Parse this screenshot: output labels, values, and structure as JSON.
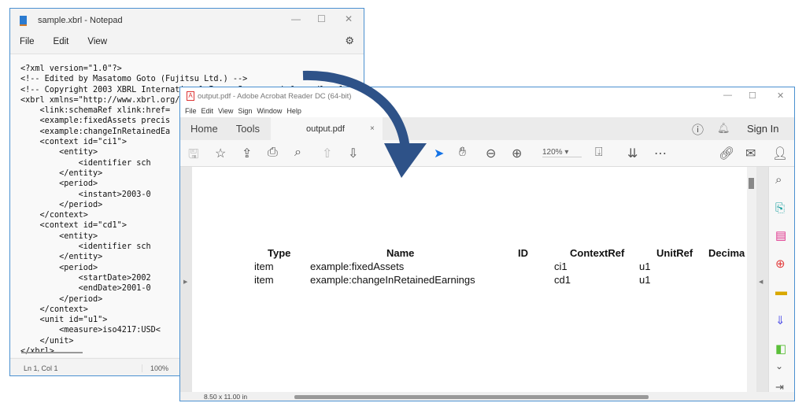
{
  "notepad": {
    "title": "sample.xbrl - Notepad",
    "menu": [
      "File",
      "Edit",
      "View"
    ],
    "code": "<?xml version=\"1.0\"?>\n<!-- Edited by Masatomo Goto (Fujitsu Ltd.) -->\n<!-- Copyright 2003 XBRL International Inc.  See www.xbrl.org/legal\n<xbrl xmlns=\"http://www.xbrl.org/\n\t<link:schemaRef xlink:href=\n\t<example:fixedAssets precis\n\t<example:changeInRetainedEa\n\t<context id=\"ci1\">\n\t\t<entity>\n\t\t\t<identifier sch\n\t\t</entity>\n\t\t<period>\n\t\t\t<instant>2003-0\n\t\t</period>\n\t</context>\n\t<context id=\"cd1\">\n\t\t<entity>\n\t\t\t<identifier sch\n\t\t</entity>\n\t\t<period>\n\t\t\t<startDate>2002\n\t\t\t<endDate>2001-0\n\t\t</period>\n\t</context>\n\t<unit id=\"u1\">\n\t\t<measure>iso4217:USD<\n\t</unit>\n</xbrl>",
    "status": {
      "position": "Ln 1, Col 1",
      "zoom": "100%"
    }
  },
  "acrobat": {
    "title": "output.pdf - Adobe Acrobat Reader DC (64-bit)",
    "menu": [
      "File",
      "Edit",
      "View",
      "Sign",
      "Window",
      "Help"
    ],
    "tabs": [
      "Home",
      "Tools"
    ],
    "active_tab": "output.pdf",
    "sign_in": "Sign In",
    "zoom": "120%",
    "page_size": "8.50 x 11.00 in",
    "table": {
      "headers": [
        "Type",
        "Name",
        "ID",
        "ContextRef",
        "UnitRef",
        "Decima"
      ],
      "rows": [
        [
          "item",
          "example:fixedAssets",
          "",
          "ci1",
          "u1",
          ""
        ],
        [
          "item",
          "example:changeInRetainedEarnings",
          "",
          "cd1",
          "u1",
          ""
        ]
      ]
    }
  },
  "colors": {
    "arrow": "#2e5288",
    "window_border": "#4a90d0"
  }
}
